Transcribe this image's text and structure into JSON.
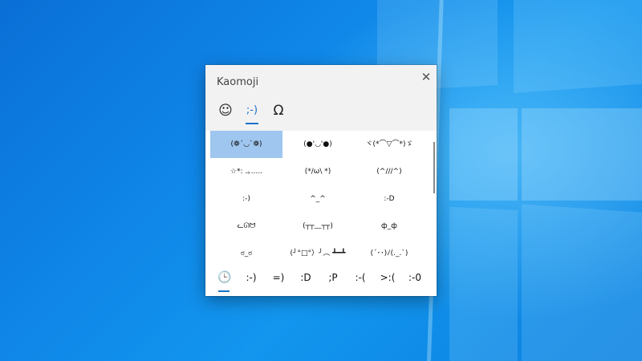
{
  "window": {
    "title": "Kaomoji",
    "close_symbol": "✕"
  },
  "tabs": [
    {
      "icon": "smiley-icon",
      "glyph": "☺",
      "active": false
    },
    {
      "icon": "kaomoji-icon",
      "glyph": ";-)",
      "active": true
    },
    {
      "icon": "omega-icon",
      "glyph": "Ω",
      "active": false
    }
  ],
  "grid": [
    [
      "(❁´◡`❁)",
      "(●'◡'●)",
      "ヾ(*⌒▽⌒*)ゞ"
    ],
    [
      "☆*: .｡.....",
      "(*/ω\\ *)",
      "(^///^)"
    ],
    [
      ":-)",
      "^_^",
      ":-D"
    ],
    [
      "ᓚᘏᗢ",
      "(┬┬﹏┬┬)",
      "ф_ф"
    ],
    [
      "ಠ_ಠ",
      "(╯°□°）╯︵ ┻━┻",
      "(´･･)ﾉ(._.`)"
    ]
  ],
  "selected": {
    "row": 0,
    "col": 0
  },
  "bottom_tabs": [
    {
      "icon": "clock-icon",
      "glyph": "🕒",
      "active": true
    },
    {
      "label": ":-)"
    },
    {
      "label": "=)"
    },
    {
      "label": ":D"
    },
    {
      "label": ";P"
    },
    {
      "label": ":-("
    },
    {
      "label": ">:("
    },
    {
      "label": ":-0"
    }
  ],
  "accent_color": "#1a73c8",
  "selection_color": "#9fc6ee"
}
